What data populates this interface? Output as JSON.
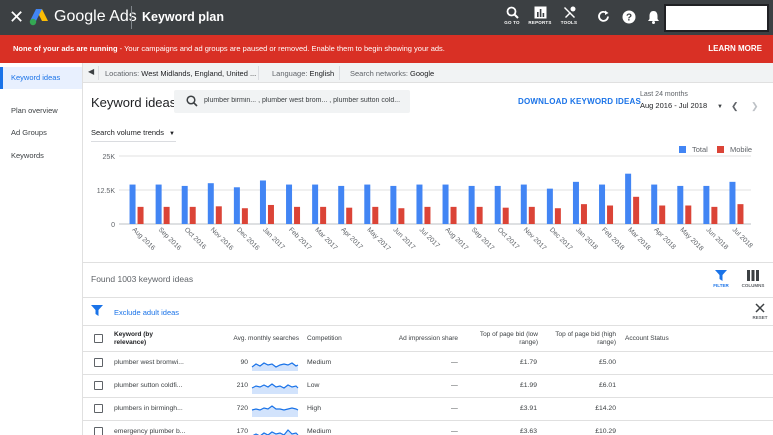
{
  "app": {
    "brand": "Google Ads",
    "page_title": "Keyword plan",
    "tools": [
      {
        "label": "GO TO",
        "icon": "search-icon"
      },
      {
        "label": "REPORTS",
        "icon": "bar-chart-icon"
      },
      {
        "label": "TOOLS",
        "icon": "wrench-icon"
      }
    ]
  },
  "banner": {
    "bold": "None of your ads are running",
    "text": " - Your campaigns and ad groups are paused or removed. Enable them to begin showing your ads.",
    "action": "LEARN MORE"
  },
  "sidebar": {
    "items": [
      {
        "label": "Keyword ideas",
        "active": true
      },
      {
        "label": "Plan overview",
        "active": false
      },
      {
        "label": "Ad Groups",
        "active": false
      },
      {
        "label": "Keywords",
        "active": false
      }
    ]
  },
  "filters": {
    "location_label": "Locations:",
    "location_value": "West Midlands, England, United ...",
    "language_label": "Language:",
    "language_value": "English",
    "network_label": "Search networks:",
    "network_value": "Google"
  },
  "main": {
    "title": "Keyword ideas",
    "search_text": "plumber birmin... , plumber west brom... , plumber sutton cold...",
    "download_label": "DOWNLOAD KEYWORD IDEAS",
    "date_label": "Last 24 months",
    "date_value": "Aug 2016 - Jul 2018",
    "trends_label": "Search volume trends",
    "found_text": "Found 1003 keyword ideas",
    "filter_label": "FILTER",
    "columns_label": "COLUMNS",
    "exclude_label": "Exclude adult ideas",
    "reset_label": "RESET"
  },
  "colors": {
    "total": "#4285f4",
    "mobile": "#db4437",
    "accent": "#1a73e8",
    "banner": "#d93025"
  },
  "chart_data": {
    "type": "bar",
    "categories": [
      "Aug 2016",
      "Sep 2016",
      "Oct 2016",
      "Nov 2016",
      "Dec 2016",
      "Jan 2017",
      "Feb 2017",
      "Mar 2017",
      "Apr 2017",
      "May 2017",
      "Jun 2017",
      "Jul 2017",
      "Aug 2017",
      "Sep 2017",
      "Oct 2017",
      "Nov 2017",
      "Dec 2017",
      "Jan 2018",
      "Feb 2018",
      "Mar 2018",
      "Apr 2018",
      "May 2018",
      "Jun 2018",
      "Jul 2018"
    ],
    "series": [
      {
        "name": "Total",
        "values": [
          14500,
          14500,
          14000,
          15000,
          13500,
          16000,
          14500,
          14500,
          14000,
          14500,
          14000,
          14500,
          14500,
          14000,
          14000,
          14500,
          13000,
          15500,
          14500,
          18500,
          14500,
          14000,
          14000,
          15500
        ]
      },
      {
        "name": "Mobile",
        "values": [
          6300,
          6300,
          6300,
          6500,
          5800,
          7000,
          6300,
          6300,
          6000,
          6300,
          5800,
          6300,
          6300,
          6300,
          6000,
          6300,
          5800,
          7300,
          6800,
          10000,
          6800,
          6800,
          6300,
          7300
        ]
      }
    ],
    "y_ticks": [
      "25K",
      "12.5K",
      "0"
    ],
    "ylim": [
      0,
      25000
    ],
    "legend_position": "top-right",
    "grid": true
  },
  "table": {
    "headers": {
      "keyword": "Keyword (by relevance)",
      "avg": "Avg. monthly searches",
      "competition": "Competition",
      "impression": "Ad impression share",
      "low_bid": "Top of page bid (low range)",
      "high_bid": "Top of page bid (high range)",
      "status": "Account Status"
    },
    "rows": [
      {
        "keyword": "plumber west bromwi...",
        "avg": "90",
        "competition": "Medium",
        "impression": "—",
        "low": "£1.79",
        "high": "£5.00"
      },
      {
        "keyword": "plumber sutton coldfi...",
        "avg": "210",
        "competition": "Low",
        "impression": "—",
        "low": "£1.99",
        "high": "£6.01"
      },
      {
        "keyword": "plumbers in birmingh...",
        "avg": "720",
        "competition": "High",
        "impression": "—",
        "low": "£3.91",
        "high": "£14.20"
      },
      {
        "keyword": "emergency plumber b...",
        "avg": "170",
        "competition": "Medium",
        "impression": "—",
        "low": "£3.63",
        "high": "£10.29"
      }
    ]
  }
}
